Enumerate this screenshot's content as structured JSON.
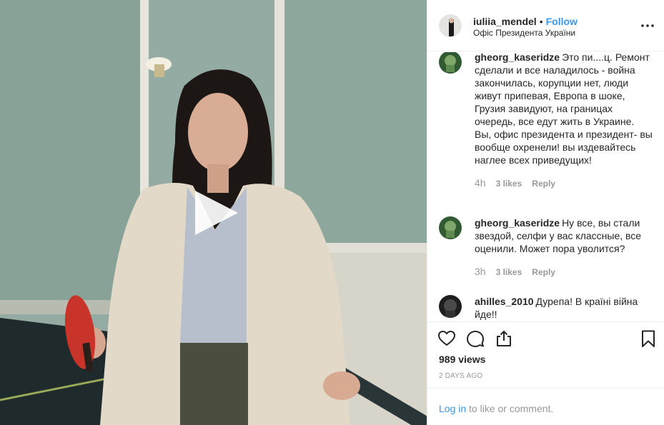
{
  "header": {
    "username": "iuliia_mendel",
    "separator": "•",
    "follow_label": "Follow",
    "location": "Офіс Президента України",
    "more_icon": "more-horizontal-icon"
  },
  "media": {
    "type": "video",
    "play_icon": "play-icon"
  },
  "comments": [
    {
      "username": "gheorg_kaseridze",
      "text": "Это пи....ц. Ремонт сделали и все наладилось - война закончилась, корупции нет, люди живут припевая, Европа в шоке, Грузия завидуют, на границах очередь, все едут жить в Украине. Вы, офис президента и президент- вы вообще охренели! вы издевайтесь наглее всех приведущих!",
      "time": "4h",
      "likes": "3 likes",
      "reply": "Reply"
    },
    {
      "username": "gheorg_kaseridze",
      "text": "Ну все, вы стали звездой, селфи у вас классные, все оценили. Может пора уволится?",
      "time": "3h",
      "likes": "3 likes",
      "reply": "Reply"
    },
    {
      "username": "ahilles_2010",
      "text": "Дурепа! В країні війна йде!!",
      "time": "",
      "likes": "",
      "reply": ""
    }
  ],
  "actions": {
    "like_icon": "heart-icon",
    "comment_icon": "comment-icon",
    "share_icon": "share-icon",
    "save_icon": "bookmark-icon"
  },
  "stats": {
    "views_count": "989",
    "views_label": "views",
    "date": "2 DAYS AGO"
  },
  "login": {
    "link_label": "Log in",
    "rest_text": "to like or comment."
  },
  "colors": {
    "link_blue": "#3897f0",
    "text_dark": "#262626",
    "text_muted": "#999999",
    "border": "#efefef"
  }
}
